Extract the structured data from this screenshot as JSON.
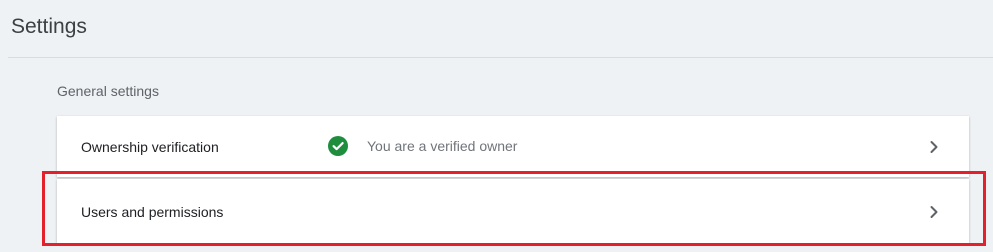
{
  "header": {
    "title": "Settings"
  },
  "general": {
    "section_label": "General settings",
    "rows": [
      {
        "label": "Ownership verification",
        "status_icon": "check-circle-icon",
        "status_text": "You are a verified owner",
        "chevron_icon": "chevron-right-icon"
      },
      {
        "label": "Users and permissions",
        "chevron_icon": "chevron-right-icon"
      }
    ]
  },
  "colors": {
    "page_background": "#eff2f5",
    "verified_green": "#1e8e3e",
    "highlight_red": "#e3202c"
  }
}
